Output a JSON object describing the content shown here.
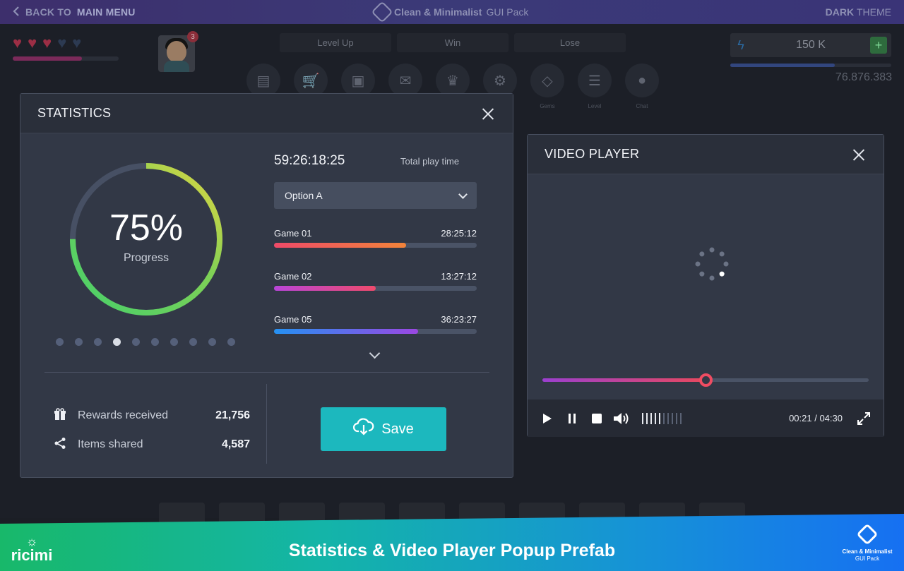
{
  "topbar": {
    "back_prefix": "BACK TO",
    "back_strong": "MAIN MENU",
    "brand_bold": "Clean & Minimalist",
    "brand_light": "GUI Pack",
    "theme_bold": "DARK",
    "theme_light": "THEME"
  },
  "background": {
    "notification_count": "3",
    "tabs": [
      "Level Up",
      "Win",
      "Lose"
    ],
    "icon_labels": [
      "",
      "",
      "",
      "",
      "",
      "",
      "Gems",
      "Level",
      "Chat"
    ],
    "currency_amount": "150 K",
    "score": "76.876.383"
  },
  "statistics": {
    "title": "STATISTICS",
    "progress_text": "75%",
    "progress_value": 0.75,
    "progress_label": "Progress",
    "carousel_dots": 10,
    "carousel_active_index": 3,
    "play_time": "59:26:18:25",
    "play_time_label": "Total play time",
    "select_value": "Option A",
    "games": [
      {
        "name": "Game 01",
        "time": "28:25:12",
        "progress": 0.65,
        "gradient": [
          "#ef4a68",
          "#f2843a"
        ]
      },
      {
        "name": "Game 02",
        "time": "13:27:12",
        "progress": 0.5,
        "gradient": [
          "#b845d8",
          "#ef4a6c"
        ]
      },
      {
        "name": "Game 05",
        "time": "36:23:27",
        "progress": 0.71,
        "gradient": [
          "#2591f2",
          "#9b47e2"
        ]
      }
    ],
    "rewards_label": "Rewards received",
    "rewards_value": "21,756",
    "shared_label": "Items shared",
    "shared_value": "4,587",
    "save_label": "Save"
  },
  "video": {
    "title": "VIDEO PLAYER",
    "seek_progress": 0.499,
    "volume_ticks_on": 5,
    "volume_ticks_total": 10,
    "current_time": "00:21",
    "separator": " / ",
    "duration": "04:30"
  },
  "footer": {
    "title": "Statistics & Video Player Popup Prefab",
    "logo_text": "ricimi",
    "brand_line1": "Clean & Minimalist",
    "brand_line2": "GUI Pack"
  },
  "colors": {
    "accent": "#1cb8be",
    "panel": "#323846",
    "ring_green": "#46cf6a",
    "ring_yellow": "#e8d640"
  }
}
